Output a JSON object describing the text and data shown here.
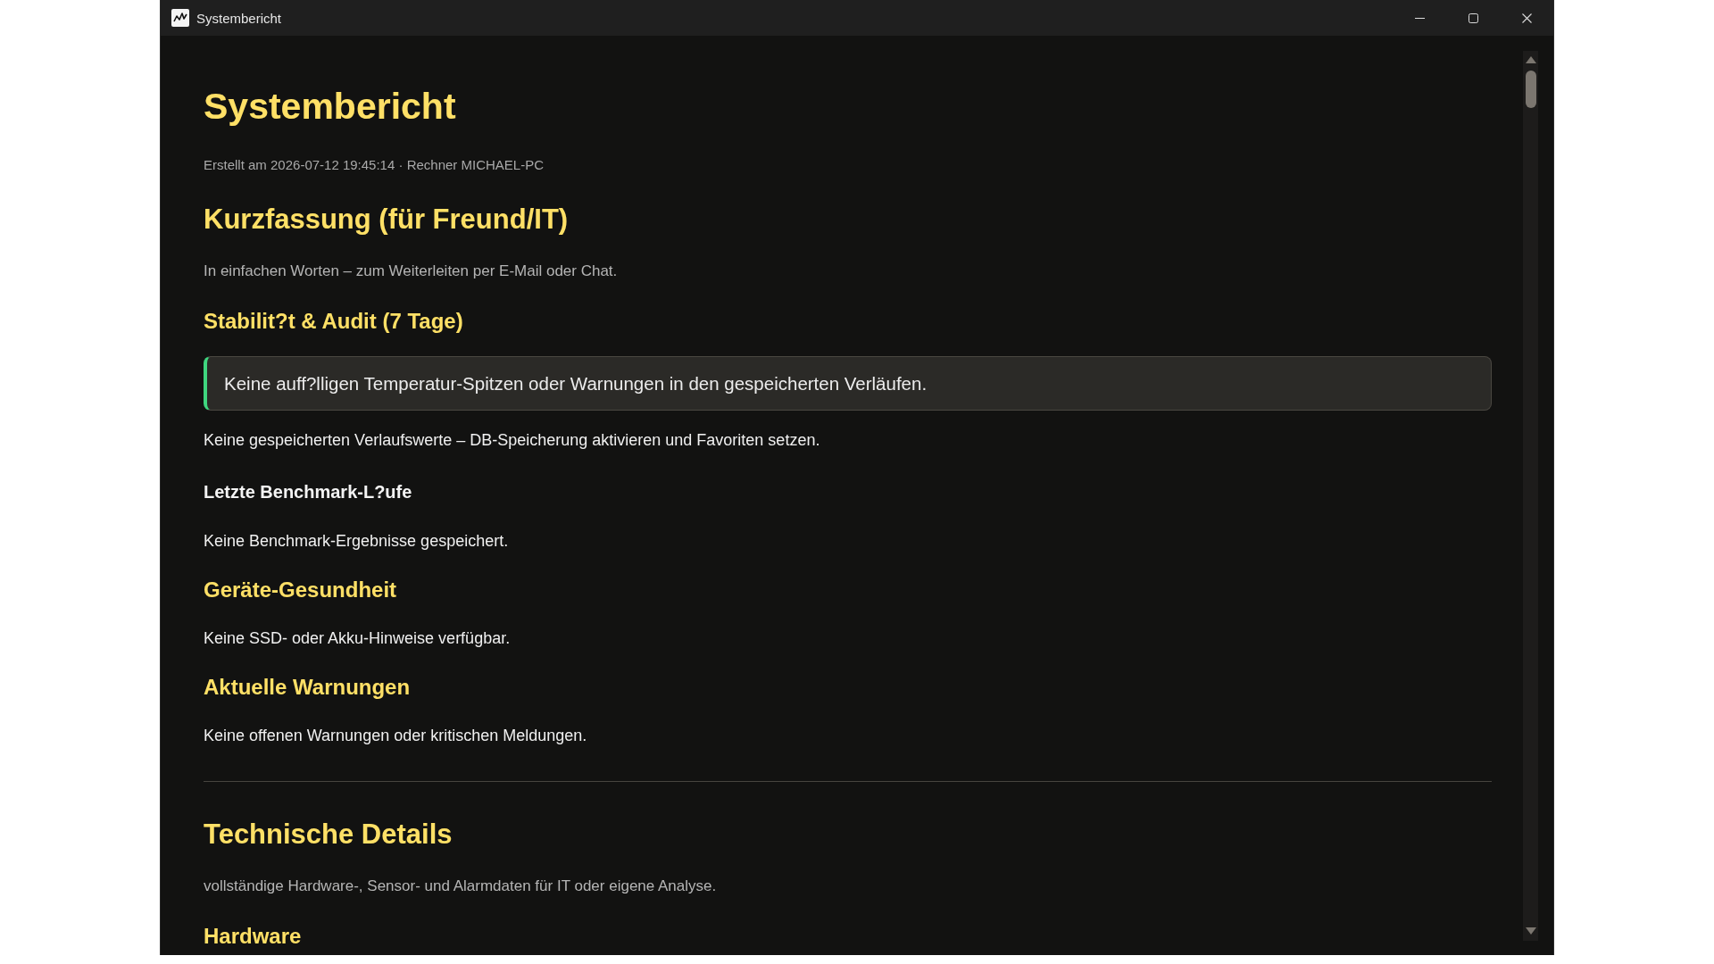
{
  "window": {
    "title": "Systembericht"
  },
  "report": {
    "title": "Systembericht",
    "meta": "Erstellt am 2026-07-12 19:45:14 · Rechner MICHAEL-PC",
    "sections": [
      {
        "heading": "Kurzfassung (für Freund/IT)",
        "intro": "In einfachen Worten – zum Weiterleiten per E-Mail oder Chat.",
        "blocks": [
          {
            "kind": "heading",
            "text": "Stabilit?t & Audit (7 Tage)"
          },
          {
            "kind": "callout",
            "text": "Keine auff?lligen Temperatur-Spitzen oder Warnungen in den gespeicherten Verläufen."
          },
          {
            "kind": "paragraph",
            "text": "Keine gespeicherten Verlaufswerte – DB-Speicherung aktivieren und Favoriten setzen."
          },
          {
            "kind": "subheading",
            "text": "Letzte Benchmark-L?ufe"
          },
          {
            "kind": "paragraph",
            "text": "Keine Benchmark-Ergebnisse gespeichert."
          },
          {
            "kind": "heading",
            "text": "Geräte-Gesundheit"
          },
          {
            "kind": "paragraph",
            "text": "Keine SSD- oder Akku-Hinweise verfügbar."
          },
          {
            "kind": "heading",
            "text": "Aktuelle Warnungen"
          },
          {
            "kind": "paragraph",
            "text": "Keine offenen Warnungen oder kritischen Meldungen."
          }
        ]
      },
      {
        "heading": "Technische Details",
        "intro": "vollständige Hardware-, Sensor- und Alarmdaten für IT oder eigene Analyse.",
        "blocks": [
          {
            "kind": "heading",
            "text": "Hardware"
          }
        ]
      }
    ]
  }
}
